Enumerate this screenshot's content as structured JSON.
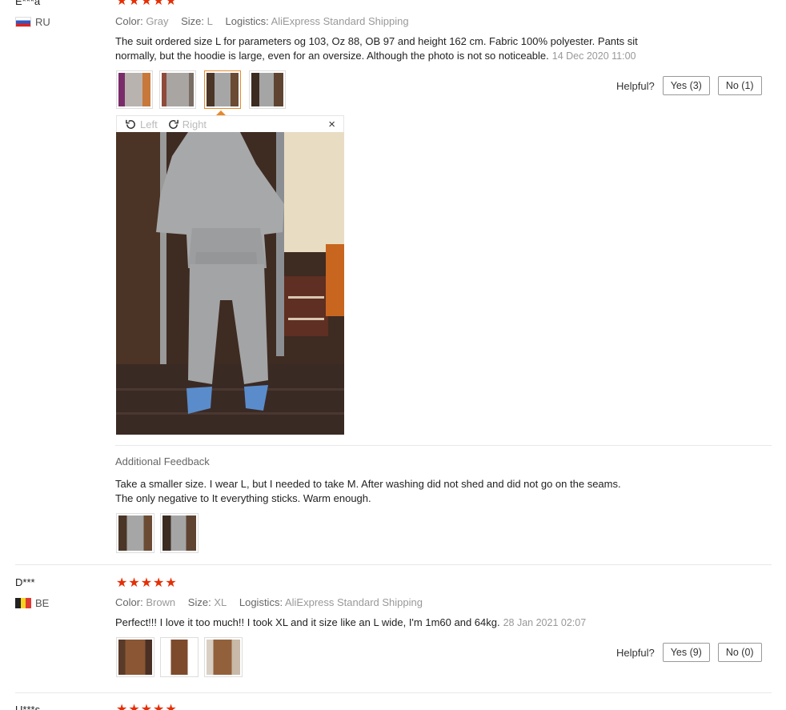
{
  "reviews": [
    {
      "user": "E***a",
      "country": "RU",
      "rating": 5,
      "color_label": "Color:",
      "color": "Gray",
      "size_label": "Size:",
      "size": "L",
      "logistics_label": "Logistics:",
      "logistics": "AliExpress Standard Shipping",
      "text_line1": "The suit ordered size L for parameters og 103, Oz 88, OB 97 and height 162 cm. Fabric 100% polyester. Pants sit",
      "text_line2": "normally, but the hoodie is large, even for an oversize. Although the photo is not so noticeable.",
      "date": "14 Dec 2020 11:00",
      "helpful_label": "Helpful?",
      "yes_label": "Yes (3)",
      "no_label": "No (1)",
      "viewer": {
        "left_label": "Left",
        "right_label": "Right",
        "close_label": "×"
      },
      "additional_title": "Additional Feedback",
      "additional_line1": "Take a smaller size. I wear L, but I needed to take M. After washing did not shed and did not go on the seams.",
      "additional_line2": "The only negative to It everything sticks. Warm enough."
    },
    {
      "user": "D***",
      "country": "BE",
      "rating": 5,
      "color_label": "Color:",
      "color": "Brown",
      "size_label": "Size:",
      "size": "XL",
      "logistics_label": "Logistics:",
      "logistics": "AliExpress Standard Shipping",
      "text_line1": "Perfect!!! I love it too much!! I took XL and it size like an L wide, I'm 1m60 and 64kg.",
      "date": "28 Jan 2021 02:07",
      "helpful_label": "Helpful?",
      "yes_label": "Yes (9)",
      "no_label": "No (0)"
    },
    {
      "user": "U***s"
    }
  ],
  "star_glyph": "★",
  "colors": {
    "star": "#e62e04",
    "selected_border": "#e6892b"
  }
}
